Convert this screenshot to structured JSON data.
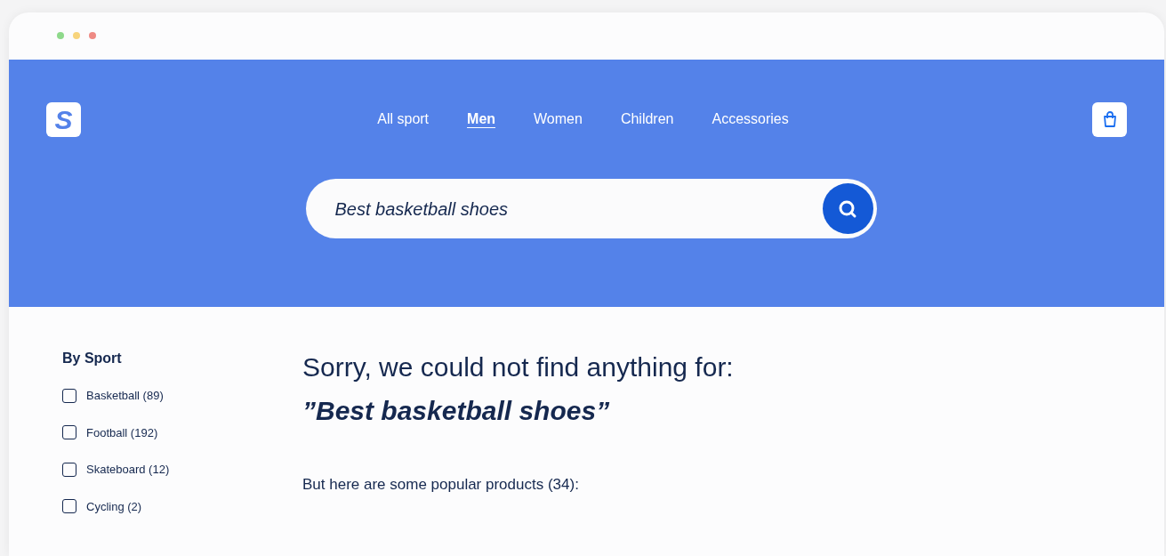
{
  "logo": "S",
  "nav": [
    {
      "label": "All sport",
      "selected": false
    },
    {
      "label": "Men",
      "selected": true
    },
    {
      "label": "Women",
      "selected": false
    },
    {
      "label": "Children",
      "selected": false
    },
    {
      "label": "Accessories",
      "selected": false
    }
  ],
  "search": {
    "value": "Best basketball shoes"
  },
  "filters": {
    "title": "By Sport",
    "items": [
      {
        "label": "Basketball (89)",
        "checked": false
      },
      {
        "label": "Football (192)",
        "checked": false
      },
      {
        "label": "Skateboard (12)",
        "checked": false
      },
      {
        "label": "Cycling (2)",
        "checked": false
      }
    ]
  },
  "message": {
    "line1": "Sorry, we could not find anything for:",
    "query": "”Best basketball shoes”",
    "popular": "But here are some popular products (34):"
  }
}
